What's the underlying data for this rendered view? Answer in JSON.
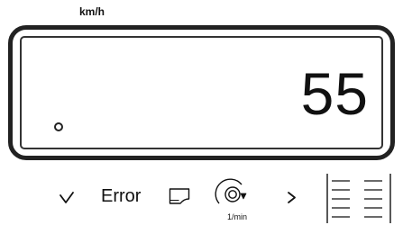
{
  "display": {
    "unit": "km/h",
    "value": "55",
    "indicator_icon": "circle-indicator-icon"
  },
  "keypad": {
    "down_key_icon": "check-down-arrow-icon",
    "error_label": "Error",
    "tray_key_icon": "hopper-tray-icon",
    "rpm_key_icon": "rotation-sensor-icon",
    "rpm_unit": "1/min",
    "right_key_icon": "chevron-right-icon",
    "list_key_icon": "list-lines-icon"
  }
}
